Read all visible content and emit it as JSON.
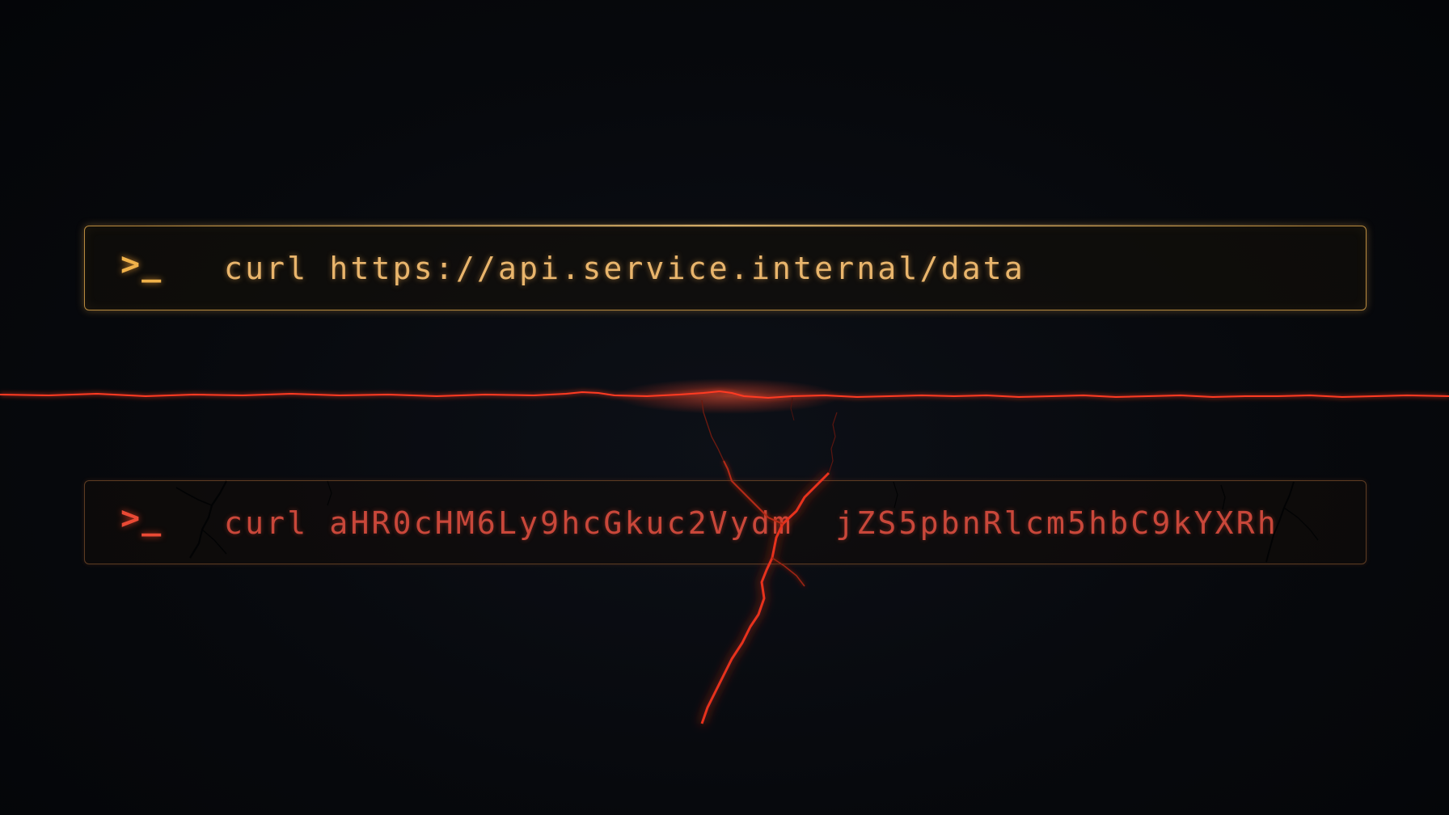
{
  "top_terminal": {
    "prompt": ">_",
    "command": "curl https://api.service.internal/data",
    "accent_color": "#f0b24a"
  },
  "bottom_terminal": {
    "prompt": ">_",
    "command": "curl aHR0cHM6Ly9hcGkuc2Vydm  jZS5pbnRlcm5hbC9kYXRh",
    "accent_color": "#ea4a35"
  },
  "divider": {
    "color": "#ff3a22"
  }
}
